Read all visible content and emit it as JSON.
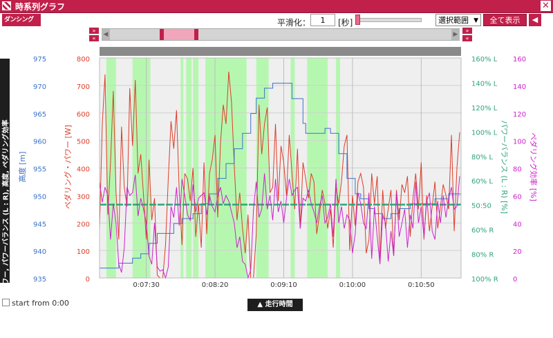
{
  "window": {
    "title": "時系列グラフ",
    "close_icon": "close-icon"
  },
  "logo": {
    "text": "ダンシング"
  },
  "toolbar": {
    "smoothing_label": "平滑化：",
    "smoothing_value": "1",
    "unit_label": "[秒]",
    "range_select": "選択範囲",
    "show_all": "全て表示",
    "back": "◀"
  },
  "nav": {
    "right": "»",
    "left": "«",
    "scroll_left": "◀",
    "scroll_right": "▶"
  },
  "side_tab": "▼ペダリング・パワー, パワーバランス (L : R), 高度, ペダリング効率",
  "bottom": {
    "start_from": "start from 0:00",
    "x_tab": "▲ 走行時間"
  },
  "colors": {
    "power": "#dd3c28",
    "altitude": "#3a72c8",
    "balance": "#2fa37a",
    "efficiency": "#cc22cc",
    "green_band": "#b6f7b0",
    "brand": "#c0204a"
  },
  "chart_data": {
    "type": "line",
    "x_ticks": [
      "0:07:30",
      "0:08:20",
      "0:09:10",
      "0:10:00",
      "0:10:50"
    ],
    "x_tick_seconds": [
      450,
      500,
      550,
      600,
      650
    ],
    "xlim": [
      416,
      679
    ],
    "axes": {
      "altitude": {
        "label": "高度 [m]",
        "ticks": [
          "975",
          "970",
          "965",
          "960",
          "955",
          "950",
          "945",
          "940",
          "935"
        ],
        "ylim": [
          935,
          975
        ]
      },
      "power": {
        "label": "ペダリング・パワー [W]",
        "ticks": [
          "800",
          "700",
          "600",
          "500",
          "400",
          "300",
          "200",
          "100",
          "0"
        ],
        "ylim": [
          0,
          800
        ]
      },
      "balance": {
        "label": "パワーバランス (L : R) [%]",
        "ticks": [
          "160% L",
          "140% L",
          "120% L",
          "100% L",
          "80% L",
          "60% L",
          "50:50",
          "60% R",
          "80% R",
          "100% R"
        ]
      },
      "efficiency": {
        "label": "ペダリング効率 [%]",
        "ticks": [
          "160",
          "140",
          "120",
          "100",
          "80",
          "60",
          "40",
          "20",
          "0"
        ],
        "ylim": [
          0,
          160
        ]
      }
    },
    "green_bands": [
      [
        421,
        428
      ],
      [
        440,
        453
      ],
      [
        475,
        477
      ],
      [
        479,
        483
      ],
      [
        484,
        488
      ],
      [
        493,
        523
      ],
      [
        530,
        539
      ],
      [
        555,
        558
      ],
      [
        567,
        582
      ],
      [
        588,
        591
      ]
    ],
    "series": [
      {
        "name": "ペダリング・パワー",
        "axis": "power",
        "x": [
          416,
          418,
          420,
          422,
          424,
          426,
          428,
          430,
          432,
          434,
          436,
          438,
          440,
          442,
          444,
          446,
          448,
          450,
          452,
          454,
          456,
          458,
          460,
          462,
          464,
          466,
          468,
          470,
          472,
          474,
          476,
          478,
          480,
          482,
          484,
          486,
          488,
          490,
          492,
          494,
          496,
          498,
          500,
          502,
          504,
          506,
          508,
          510,
          512,
          514,
          516,
          518,
          520,
          522,
          524,
          526,
          528,
          530,
          532,
          534,
          536,
          538,
          540,
          542,
          544,
          546,
          548,
          550,
          552,
          554,
          556,
          558,
          560,
          562,
          564,
          566,
          568,
          570,
          572,
          574,
          576,
          578,
          580,
          582,
          584,
          586,
          588,
          590,
          592,
          594,
          596,
          598,
          600,
          602,
          604,
          606,
          608,
          610,
          612,
          614,
          616,
          618,
          620,
          622,
          624,
          626,
          628,
          630,
          632,
          634,
          636,
          638,
          640,
          642,
          644,
          646,
          648,
          650,
          652,
          654,
          656,
          658,
          660,
          662,
          664,
          666,
          668,
          670,
          672,
          674,
          676,
          678
        ],
        "values": [
          180,
          560,
          740,
          230,
          420,
          680,
          310,
          140,
          550,
          330,
          260,
          690,
          480,
          720,
          380,
          450,
          300,
          140,
          430,
          210,
          290,
          10,
          0,
          0,
          120,
          360,
          570,
          470,
          610,
          310,
          120,
          380,
          360,
          280,
          400,
          150,
          270,
          110,
          420,
          160,
          380,
          430,
          520,
          220,
          490,
          630,
          560,
          750,
          640,
          410,
          210,
          310,
          180,
          90,
          230,
          0,
          0,
          160,
          630,
          450,
          560,
          620,
          310,
          330,
          560,
          280,
          480,
          420,
          300,
          520,
          380,
          250,
          470,
          180,
          420,
          360,
          290,
          380,
          350,
          160,
          230,
          320,
          270,
          180,
          250,
          110,
          330,
          270,
          350,
          480,
          520,
          100,
          300,
          190,
          350,
          380,
          330,
          90,
          140,
          380,
          270,
          370,
          60,
          320,
          180,
          250,
          320,
          80,
          320,
          210,
          340,
          310,
          370,
          150,
          290,
          380,
          250,
          420,
          140,
          300,
          170,
          260,
          350,
          180,
          260,
          340,
          300,
          250,
          520,
          170,
          400,
          530
        ]
      },
      {
        "name": "高度",
        "axis": "altitude",
        "x": [
          416,
          426,
          430,
          440,
          446,
          452,
          458,
          470,
          476,
          484,
          490,
          496,
          502,
          508,
          514,
          520,
          526,
          530,
          536,
          542,
          548,
          556,
          564,
          566,
          576,
          580,
          584,
          590,
          596,
          602,
          606,
          612,
          616,
          622,
          628,
          634,
          642,
          650,
          660,
          670,
          676
        ],
        "values": [
          936.8,
          936.8,
          937.7,
          938.6,
          939.4,
          941.3,
          943.1,
          944.9,
          945.8,
          946.7,
          948.5,
          950.3,
          953.1,
          955.8,
          958.5,
          961.3,
          964.9,
          967.7,
          969.5,
          970.4,
          970.4,
          967.6,
          963.1,
          961.3,
          961.3,
          962.2,
          961.3,
          957.6,
          953.1,
          950.3,
          949.4,
          947.6,
          946.7,
          945.8,
          946.7,
          947.6,
          948.5,
          948.5,
          949.4,
          950.3,
          950.3
        ]
      },
      {
        "name": "パワーバランス (L : R)",
        "axis": "balance",
        "x": [
          416,
          679
        ],
        "values": [
          50,
          50
        ]
      },
      {
        "name": "ペダリング効率",
        "axis": "efficiency",
        "x": [
          416,
          418,
          420,
          422,
          424,
          426,
          428,
          430,
          432,
          434,
          436,
          438,
          440,
          442,
          444,
          446,
          448,
          450,
          452,
          454,
          456,
          458,
          460,
          462,
          464,
          466,
          468,
          470,
          472,
          474,
          476,
          478,
          480,
          482,
          484,
          486,
          488,
          490,
          492,
          494,
          496,
          498,
          500,
          502,
          504,
          506,
          508,
          510,
          512,
          514,
          516,
          518,
          520,
          522,
          524,
          526,
          528,
          530,
          532,
          534,
          536,
          538,
          540,
          542,
          544,
          546,
          548,
          550,
          552,
          554,
          556,
          558,
          560,
          562,
          564,
          566,
          568,
          570,
          572,
          574,
          576,
          578,
          580,
          582,
          584,
          586,
          588,
          590,
          592,
          594,
          596,
          598,
          600,
          602,
          604,
          606,
          608,
          610,
          612,
          614,
          616,
          618,
          620,
          622,
          624,
          626,
          628,
          630,
          632,
          634,
          636,
          638,
          640,
          642,
          644,
          646,
          648,
          650,
          652,
          654,
          656,
          658,
          660,
          662,
          664,
          666,
          668,
          670,
          672,
          674,
          676,
          678
        ],
        "values": [
          70,
          55,
          66,
          60,
          28,
          54,
          40,
          10,
          4,
          22,
          66,
          60,
          62,
          75,
          45,
          58,
          50,
          40,
          16,
          10,
          40,
          8,
          5,
          6,
          0,
          8,
          52,
          44,
          66,
          38,
          72,
          60,
          46,
          42,
          68,
          48,
          58,
          60,
          62,
          46,
          60,
          52,
          48,
          60,
          66,
          54,
          60,
          56,
          48,
          40,
          22,
          30,
          12,
          10,
          0,
          6,
          50,
          70,
          44,
          50,
          76,
          50,
          60,
          42,
          72,
          48,
          56,
          40,
          58,
          72,
          60,
          64,
          66,
          36,
          58,
          56,
          64,
          54,
          48,
          40,
          52,
          60,
          40,
          44,
          54,
          30,
          72,
          40,
          52,
          36,
          46,
          42,
          18,
          32,
          62,
          54,
          40,
          36,
          62,
          14,
          52,
          30,
          10,
          46,
          40,
          12,
          34,
          16,
          62,
          30,
          40,
          50,
          22,
          46,
          36,
          70,
          40,
          52,
          30,
          56,
          62,
          34,
          28,
          56,
          40,
          60,
          44,
          58,
          66,
          50,
          52,
          74
        ]
      }
    ]
  }
}
